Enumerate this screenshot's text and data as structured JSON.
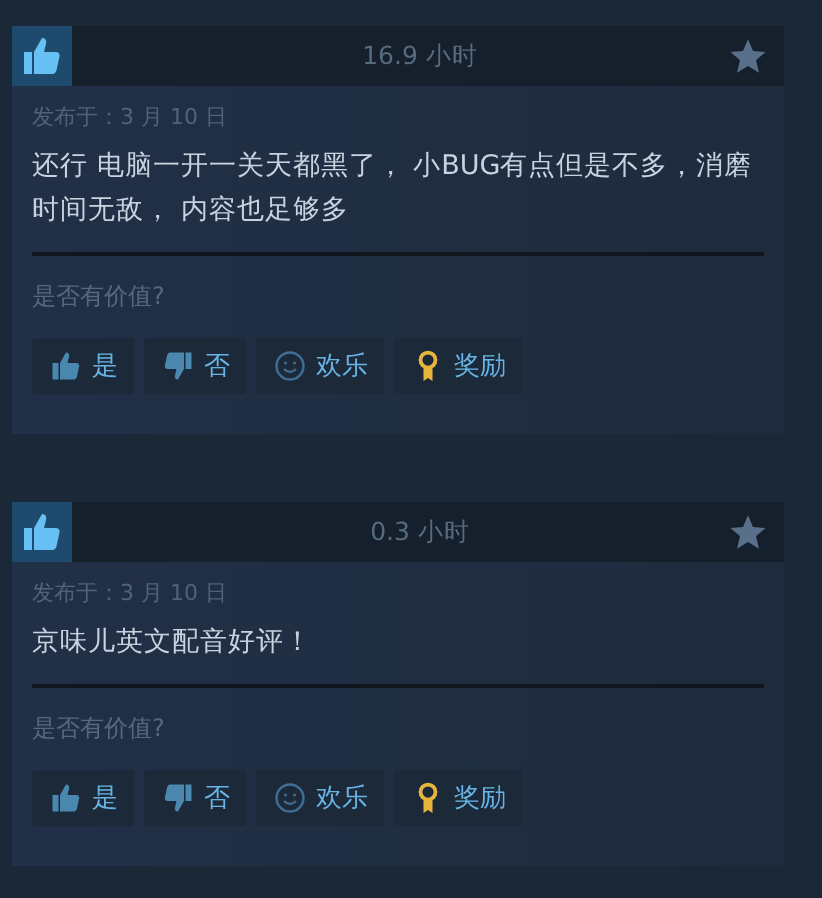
{
  "reviews": [
    {
      "recommended": true,
      "hours": "16.9 小时",
      "posted": "发布于：3 月 10 日",
      "text": "还行 电脑一开一关天都黑了， 小BUG有点但是不多，消磨时间无敌， 内容也足够多",
      "helpful_prompt": "是否有价值?",
      "buttons": [
        {
          "kind": "up",
          "label": "是"
        },
        {
          "kind": "down",
          "label": "否"
        },
        {
          "kind": "funny",
          "label": "欢乐"
        },
        {
          "kind": "award",
          "label": "奖励"
        }
      ]
    },
    {
      "recommended": true,
      "hours": "0.3 小时",
      "posted": "发布于：3 月 10 日",
      "text": "京味儿英文配音好评！",
      "helpful_prompt": "是否有价值?",
      "buttons": [
        {
          "kind": "up",
          "label": "是"
        },
        {
          "kind": "down",
          "label": "否"
        },
        {
          "kind": "funny",
          "label": "欢乐"
        },
        {
          "kind": "award",
          "label": "奖励"
        }
      ]
    }
  ]
}
